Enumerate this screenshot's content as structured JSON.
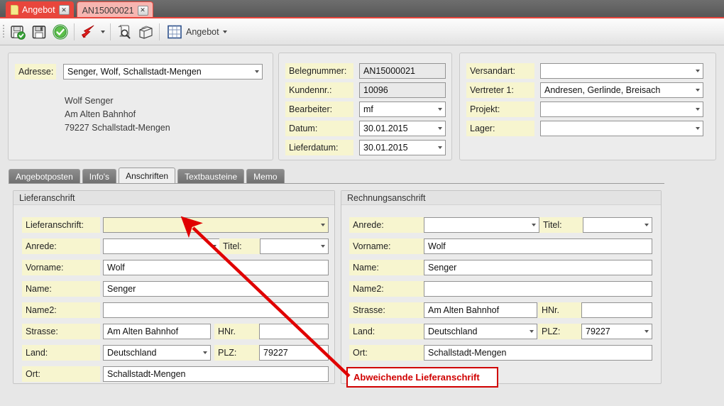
{
  "window": {
    "tabs": [
      {
        "label": "Angebot",
        "active": true,
        "close": "✕",
        "icon": "document-icon"
      },
      {
        "label": "AN15000021",
        "active": false,
        "close": "✕",
        "icon": null
      }
    ]
  },
  "toolbar": {
    "buttons": [
      {
        "name": "save-and-check-button",
        "icon": "floppy-check-icon"
      },
      {
        "name": "save-button",
        "icon": "floppy-icon"
      },
      {
        "name": "confirm-button",
        "icon": "green-check-icon"
      },
      {
        "name": "quick-action-button",
        "icon": "red-arrow-icon"
      },
      {
        "name": "preview-button",
        "icon": "scroll-magnifier-icon"
      },
      {
        "name": "print-button",
        "icon": "printer-icon"
      },
      {
        "name": "grid-button",
        "icon": "grid-icon"
      }
    ],
    "menu_label": "Angebot",
    "menu_caret": "▾"
  },
  "address_panel": {
    "label": "Adresse:",
    "value": "Senger, Wolf, Schallstadt-Mengen",
    "lines": [
      "Wolf Senger",
      "Am Alten Bahnhof",
      "79227 Schallstadt-Mengen"
    ]
  },
  "beleg_panel": {
    "rows": [
      {
        "label": "Belegnummer:",
        "value": "AN15000021",
        "type": "readonly"
      },
      {
        "label": "Kundennr.:",
        "value": "10096",
        "type": "readonly"
      },
      {
        "label": "Bearbeiter:",
        "value": "mf",
        "type": "select"
      },
      {
        "label": "Datum:",
        "value": "30.01.2015",
        "type": "select"
      },
      {
        "label": "Lieferdatum:",
        "value": "30.01.2015",
        "type": "select"
      }
    ]
  },
  "right_panel": {
    "rows": [
      {
        "label": "Versandart:",
        "value": "",
        "type": "select"
      },
      {
        "label": "Vertreter 1:",
        "value": "Andresen, Gerlinde, Breisach",
        "type": "select"
      },
      {
        "label": "Projekt:",
        "value": "",
        "type": "select"
      },
      {
        "label": "Lager:",
        "value": "",
        "type": "select"
      }
    ]
  },
  "inner_tabs": [
    {
      "label": "Angebotposten",
      "selected": false
    },
    {
      "label": "Info's",
      "selected": false
    },
    {
      "label": "Anschriften",
      "selected": true
    },
    {
      "label": "Textbausteine",
      "selected": false
    },
    {
      "label": "Memo",
      "selected": false
    }
  ],
  "lieferanschrift": {
    "title": "Lieferanschrift",
    "fields": {
      "lieferanschrift_label": "Lieferanschrift:",
      "lieferanschrift_value": "",
      "anrede_label": "Anrede:",
      "anrede_value": "",
      "titel_label": "Titel:",
      "titel_value": "",
      "vorname_label": "Vorname:",
      "vorname_value": "Wolf",
      "name_label": "Name:",
      "name_value": "Senger",
      "name2_label": "Name2:",
      "name2_value": "",
      "strasse_label": "Strasse:",
      "strasse_value": "Am Alten Bahnhof",
      "hnr_label": "HNr.",
      "hnr_value": "",
      "land_label": "Land:",
      "land_value": "Deutschland",
      "plz_label": "PLZ:",
      "plz_value": "79227",
      "ort_label": "Ort:",
      "ort_value": "Schallstadt-Mengen"
    }
  },
  "rechnungsanschrift": {
    "title": "Rechnungsanschrift",
    "fields": {
      "anrede_label": "Anrede:",
      "anrede_value": "",
      "titel_label": "Titel:",
      "titel_value": "",
      "vorname_label": "Vorname:",
      "vorname_value": "Wolf",
      "name_label": "Name:",
      "name_value": "Senger",
      "name2_label": "Name2:",
      "name2_value": "",
      "strasse_label": "Strasse:",
      "strasse_value": "Am Alten Bahnhof",
      "hnr_label": "HNr.",
      "hnr_value": "",
      "land_label": "Land:",
      "land_value": "Deutschland",
      "plz_label": "PLZ:",
      "plz_value": "79227",
      "ort_label": "Ort:",
      "ort_value": "Schallstadt-Mengen"
    }
  },
  "annotation": {
    "text": "Abweichende Lieferanschrift",
    "color": "#d00000"
  },
  "colors": {
    "accent_red": "#e8463c",
    "label_yellow": "#f7f5cf",
    "panel_gray": "#ececec",
    "toolbar_gray": "#f2f2f2"
  }
}
